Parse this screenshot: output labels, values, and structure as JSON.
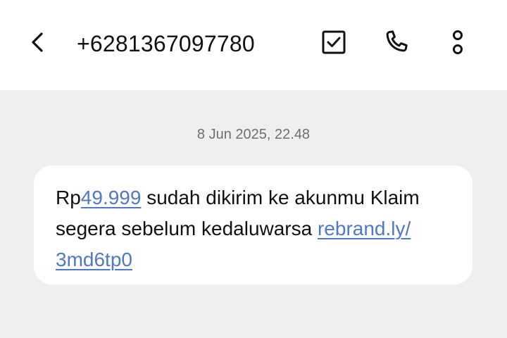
{
  "header": {
    "back_icon": "chevron-left-icon",
    "title": "+6281367097780",
    "actions": [
      {
        "icon": "select-checkbox-icon"
      },
      {
        "icon": "phone-icon"
      },
      {
        "icon": "more-vert-icon"
      }
    ]
  },
  "conversation": {
    "timestamp": "8 Jun 2025, 22.48",
    "message": {
      "prefix": "Rp",
      "amount_link": "49.999",
      "body": " sudah dikirim ke akunmu Klaim segera sebelum kedaluwarsa ",
      "url_part1": "rebrand.ly/",
      "url_part2": "3md6tp0"
    }
  },
  "colors": {
    "link": "#4f78c9",
    "background": "#efeff1",
    "bubble": "#ffffff"
  }
}
